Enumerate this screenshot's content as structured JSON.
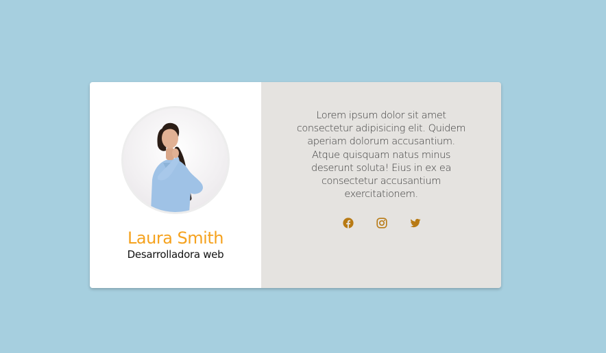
{
  "profile": {
    "name": "Laura Smith",
    "role": "Desarrolladora web",
    "bio": "Lorem ipsum dolor sit amet consectetur adipisicing elit. Quidem aperiam dolorum accusantium. Atque quisquam natus minus deserunt soluta! Eius in ex ea consectetur accusantium exercitationem."
  },
  "social": {
    "items": [
      {
        "icon": "facebook-icon"
      },
      {
        "icon": "instagram-icon"
      },
      {
        "icon": "twitter-icon"
      }
    ]
  },
  "colors": {
    "background": "#a6cfdf",
    "card_left": "#ffffff",
    "card_right": "#e5e3e0",
    "accent": "#f5a21e",
    "icon": "#b87a14"
  }
}
